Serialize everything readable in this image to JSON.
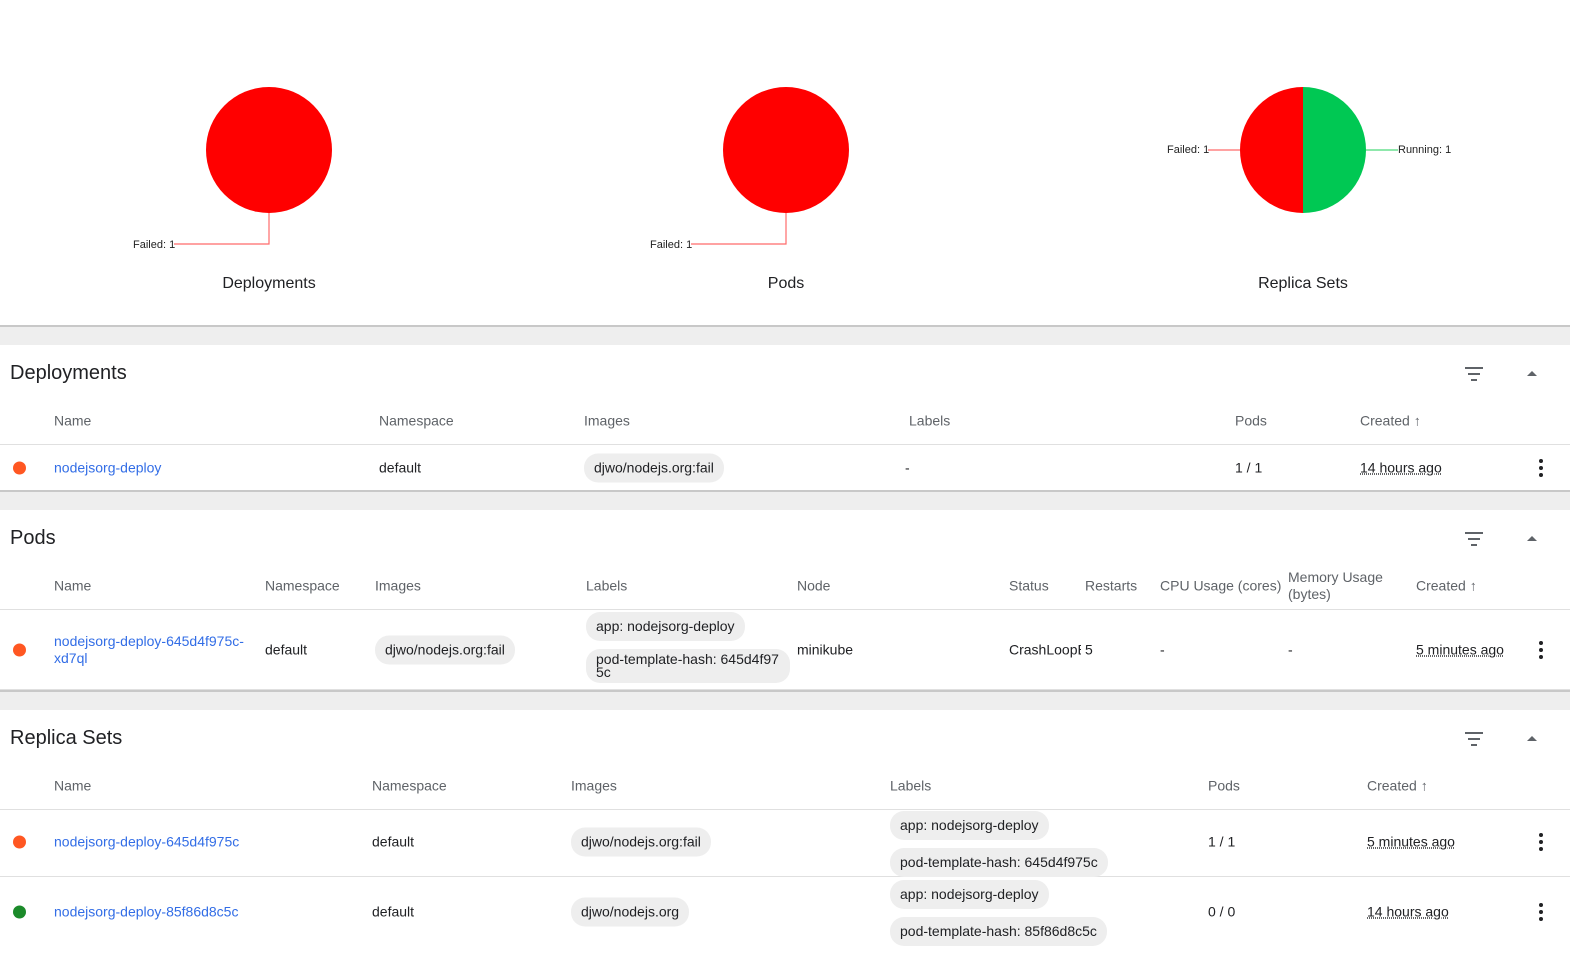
{
  "colors": {
    "failed": "#ff0000",
    "running": "#00c853",
    "status_red": "#ff5722",
    "status_green": "#1b8a2a",
    "link": "#326de6"
  },
  "chart_data": [
    {
      "type": "pie",
      "title": "Deployments",
      "series": [
        {
          "values": [
            1
          ],
          "categories": [
            "Failed: 1"
          ]
        }
      ]
    },
    {
      "type": "pie",
      "title": "Pods",
      "series": [
        {
          "values": [
            1
          ],
          "categories": [
            "Failed: 1"
          ]
        }
      ]
    },
    {
      "type": "pie",
      "title": "Replica Sets",
      "series": [
        {
          "values": [
            1,
            1
          ],
          "categories": [
            "Failed: 1",
            "Running: 1"
          ]
        }
      ]
    }
  ],
  "charts": {
    "deployments": {
      "title": "Deployments",
      "failed_label": "Failed: 1"
    },
    "pods": {
      "title": "Pods",
      "failed_label": "Failed: 1"
    },
    "replica_sets": {
      "title": "Replica Sets",
      "failed_label": "Failed: 1",
      "running_label": "Running: 1"
    }
  },
  "deployments": {
    "title": "Deployments",
    "headers": {
      "name": "Name",
      "namespace": "Namespace",
      "images": "Images",
      "labels": "Labels",
      "pods": "Pods",
      "created": "Created"
    },
    "rows": [
      {
        "status": "failed",
        "name": "nodejsorg-deploy",
        "namespace": "default",
        "image": "djwo/nodejs.org:fail",
        "labels": "-",
        "pods": "1 / 1",
        "created": "14 hours ago"
      }
    ]
  },
  "pods": {
    "title": "Pods",
    "headers": {
      "name": "Name",
      "namespace": "Namespace",
      "images": "Images",
      "labels": "Labels",
      "node": "Node",
      "status": "Status",
      "restarts": "Restarts",
      "cpu": "CPU Usage (cores)",
      "memory_1": "Memory Usage",
      "memory_2": "(bytes)",
      "created": "Created"
    },
    "rows": [
      {
        "status_dot": "failed",
        "name_1": "nodejsorg-deploy-645d4f975c-",
        "name_2": "xd7ql",
        "namespace": "default",
        "image": "djwo/nodejs.org:fail",
        "label_1": "app: nodejsorg-deploy",
        "label_2a": "pod-template-hash: 645d4f97",
        "label_2b": "5c",
        "node": "minikube",
        "status": "CrashLoopB",
        "restarts": "5",
        "cpu": "-",
        "memory": "-",
        "created": "5 minutes ago"
      }
    ]
  },
  "replica_sets": {
    "title": "Replica Sets",
    "headers": {
      "name": "Name",
      "namespace": "Namespace",
      "images": "Images",
      "labels": "Labels",
      "pods": "Pods",
      "created": "Created"
    },
    "rows": [
      {
        "status": "failed",
        "name": "nodejsorg-deploy-645d4f975c",
        "namespace": "default",
        "image": "djwo/nodejs.org:fail",
        "label_1": "app: nodejsorg-deploy",
        "label_2": "pod-template-hash: 645d4f975c",
        "pods": "1 / 1",
        "created": "5 minutes ago"
      },
      {
        "status": "running",
        "name": "nodejsorg-deploy-85f86d8c5c",
        "namespace": "default",
        "image": "djwo/nodejs.org",
        "label_1": "app: nodejsorg-deploy",
        "label_2": "pod-template-hash: 85f86d8c5c",
        "pods": "0 / 0",
        "created": "14 hours ago"
      }
    ]
  }
}
